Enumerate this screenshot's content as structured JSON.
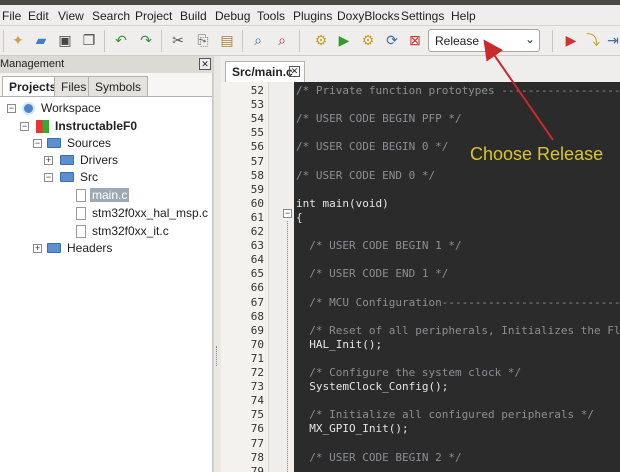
{
  "menu": [
    "File",
    "Edit",
    "View",
    "Search",
    "Project",
    "Build",
    "Debug",
    "Tools",
    "Plugins",
    "DoxyBlocks",
    "Settings",
    "Help"
  ],
  "toolbar": {
    "build_target": "Release",
    "icons": [
      "new-file-icon",
      "open-file-icon",
      "save-icon",
      "save-all-icon",
      "undo-icon",
      "redo-icon",
      "cut-icon",
      "copy-icon",
      "paste-icon",
      "find-icon",
      "replace-icon",
      "build-icon",
      "run-icon",
      "build-run-icon",
      "rebuild-icon",
      "abort-icon",
      "debug-run-icon",
      "debug-step-icon",
      "debug-next-icon"
    ]
  },
  "management": {
    "title": "Management",
    "tabs": [
      "Projects",
      "Files",
      "Symbols"
    ],
    "tree": {
      "workspace": "Workspace",
      "project": "InstructableF0",
      "sources": "Sources",
      "drivers": "Drivers",
      "src": "Src",
      "files": [
        "main.c",
        "stm32f0xx_hal_msp.c",
        "stm32f0xx_it.c"
      ],
      "headers": "Headers"
    }
  },
  "editor": {
    "tab": "Src/main.c",
    "lines": [
      {
        "n": "52",
        "t": "/* Private function prototypes -----------------------------------------------",
        "c": true
      },
      {
        "n": "53",
        "t": "",
        "c": false
      },
      {
        "n": "54",
        "t": "/* USER CODE BEGIN PFP */",
        "c": true
      },
      {
        "n": "55",
        "t": "",
        "c": false
      },
      {
        "n": "56",
        "t": "/* USER CODE BEGIN 0 */",
        "c": true
      },
      {
        "n": "57",
        "t": "",
        "c": false
      },
      {
        "n": "58",
        "t": "/* USER CODE END 0 */",
        "c": true
      },
      {
        "n": "59",
        "t": "",
        "c": false
      },
      {
        "n": "60",
        "t": "int main(void)",
        "c": false
      },
      {
        "n": "61",
        "t": "{",
        "c": false
      },
      {
        "n": "62",
        "t": "",
        "c": false
      },
      {
        "n": "63",
        "t": "  /* USER CODE BEGIN 1 */",
        "c": true
      },
      {
        "n": "64",
        "t": "",
        "c": false
      },
      {
        "n": "65",
        "t": "  /* USER CODE END 1 */",
        "c": true
      },
      {
        "n": "66",
        "t": "",
        "c": false
      },
      {
        "n": "67",
        "t": "  /* MCU Configuration----------------------------------------------------",
        "c": true
      },
      {
        "n": "68",
        "t": "",
        "c": false
      },
      {
        "n": "69",
        "t": "  /* Reset of all peripherals, Initializes the Flash interface and the Systick. */",
        "c": true
      },
      {
        "n": "70",
        "t": "  HAL_Init();",
        "c": false
      },
      {
        "n": "71",
        "t": "",
        "c": false
      },
      {
        "n": "72",
        "t": "  /* Configure the system clock */",
        "c": true
      },
      {
        "n": "73",
        "t": "  SystemClock_Config();",
        "c": false
      },
      {
        "n": "74",
        "t": "",
        "c": false
      },
      {
        "n": "75",
        "t": "  /* Initialize all configured peripherals */",
        "c": true
      },
      {
        "n": "76",
        "t": "  MX_GPIO_Init();",
        "c": false
      },
      {
        "n": "77",
        "t": "",
        "c": false
      },
      {
        "n": "78",
        "t": "  /* USER CODE BEGIN 2 */",
        "c": true
      },
      {
        "n": "79",
        "t": "",
        "c": false
      }
    ]
  },
  "annotation": "Choose Release",
  "colors": {
    "annotation": "#d8c62d",
    "arrow": "#cc2a2a",
    "code_bg": "#2b2b2b",
    "selection": "#9ea9b6"
  }
}
